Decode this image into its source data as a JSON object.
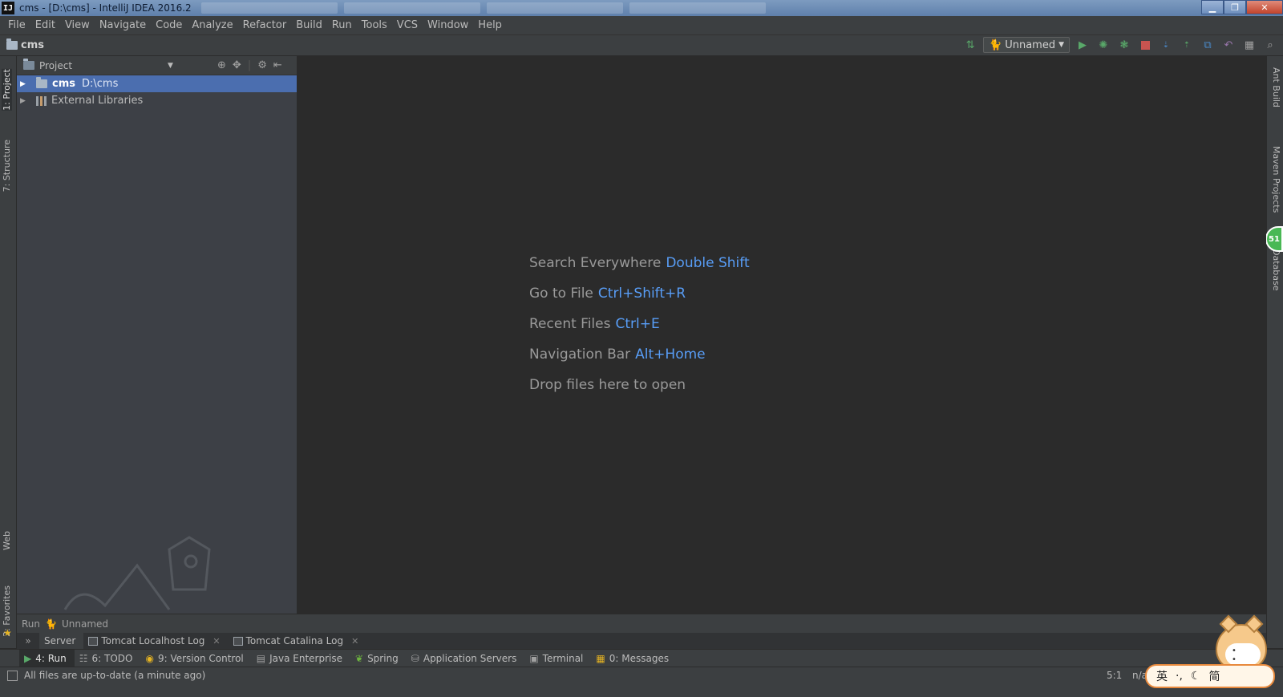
{
  "window": {
    "app_icon": "IJ",
    "title": "cms - [D:\\cms] - IntelliJ IDEA 2016.2"
  },
  "menu": [
    "File",
    "Edit",
    "View",
    "Navigate",
    "Code",
    "Analyze",
    "Refactor",
    "Build",
    "Run",
    "Tools",
    "VCS",
    "Window",
    "Help"
  ],
  "navbar": {
    "breadcrumb": "cms",
    "run_config": "Unnamed"
  },
  "left_stripe": {
    "project_tab": "1: Project",
    "structure_tab": "7: Structure",
    "web_tab": "Web",
    "favorites_tab": "2: Favorites"
  },
  "right_stripe": {
    "ant_tab": "Ant Build",
    "maven_tab": "Maven Projects",
    "database_tab": "Database",
    "badge": "51"
  },
  "project_panel": {
    "title": "Project",
    "tree": [
      {
        "name": "cms",
        "path": "D:\\cms",
        "selected": true
      },
      {
        "name": "External Libraries",
        "path": "",
        "selected": false
      }
    ]
  },
  "editor_hints": [
    {
      "label": "Search Everywhere",
      "key": "Double Shift"
    },
    {
      "label": "Go to File",
      "key": "Ctrl+Shift+R"
    },
    {
      "label": "Recent Files",
      "key": "Ctrl+E"
    },
    {
      "label": "Navigation Bar",
      "key": "Alt+Home"
    },
    {
      "label": "Drop files here to open",
      "key": ""
    }
  ],
  "run_panel": {
    "label": "Run",
    "config": "Unnamed",
    "tabs": [
      "Server",
      "Tomcat Localhost Log",
      "Tomcat Catalina Log"
    ]
  },
  "tool_windows": [
    {
      "label": "4: Run",
      "icon": "run-icon"
    },
    {
      "label": "6: TODO",
      "icon": "todo-icon"
    },
    {
      "label": "9: Version Control",
      "icon": "vcs-icon"
    },
    {
      "label": "Java Enterprise",
      "icon": "java-enterprise-icon"
    },
    {
      "label": "Spring",
      "icon": "spring-icon"
    },
    {
      "label": "Application Servers",
      "icon": "app-servers-icon"
    },
    {
      "label": "Terminal",
      "icon": "terminal-icon"
    },
    {
      "label": "0: Messages",
      "icon": "messages-icon"
    }
  ],
  "status": {
    "message": "All files are up-to-date (a minute ago)",
    "position": "5:1",
    "na": "n/a"
  },
  "ime": {
    "mode1": "英",
    "mode2": "简"
  },
  "colors": {
    "accent": "#4b6eaf",
    "key_hint": "#589df6",
    "run_green": "#59a869",
    "stop_red": "#c75450"
  }
}
